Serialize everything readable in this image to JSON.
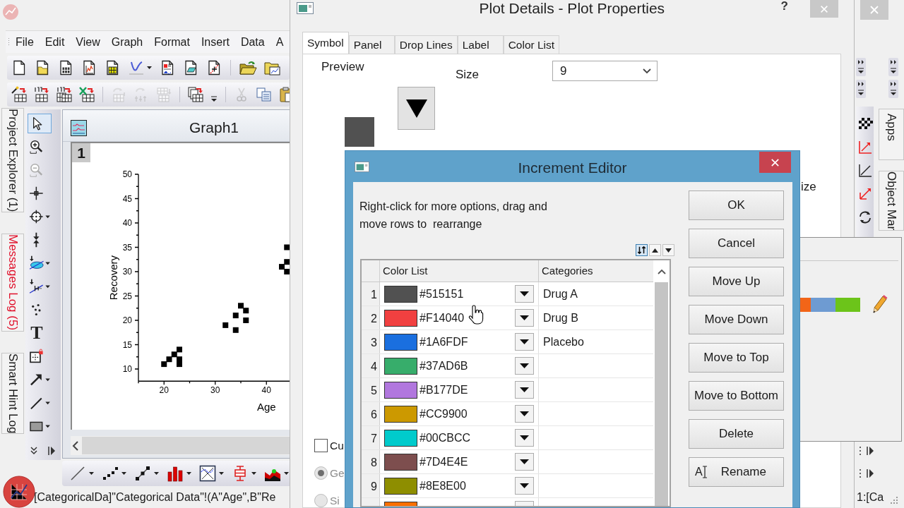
{
  "app": {
    "menu": [
      "File",
      "Edit",
      "View",
      "Graph",
      "Format",
      "Insert",
      "Data",
      "A"
    ],
    "toolbar_standard": [
      [
        {
          "kind": "new_project",
          "disabled": false
        },
        {
          "kind": "open",
          "disabled": false
        },
        {
          "kind": "new_workbook",
          "disabled": false
        },
        {
          "kind": "new_graph",
          "disabled": false
        },
        {
          "kind": "new_matrix",
          "disabled": false
        },
        {
          "kind": "new_function",
          "disabled": false
        },
        {
          "kind": "new_layout",
          "disabled": false
        },
        {
          "kind": "new_notes",
          "disabled": false
        },
        {
          "kind": "doc_marker",
          "disabled": false
        }
      ],
      [
        {
          "kind": "open_folder",
          "disabled": false
        },
        {
          "kind": "open_template",
          "disabled": false
        }
      ]
    ],
    "toolbar_import": [
      [
        {
          "kind": "import_wizard",
          "disabled": false
        },
        {
          "kind": "import_ascii",
          "disabled": false
        },
        {
          "kind": "import_multiple",
          "disabled": false
        },
        {
          "kind": "import_excel",
          "disabled": false
        }
      ],
      [
        {
          "kind": "reimport",
          "disabled": true
        },
        {
          "kind": "reimport_multi",
          "disabled": true
        },
        {
          "kind": "append_table",
          "disabled": true
        }
      ],
      [
        {
          "kind": "duplicate",
          "disabled": false
        },
        {
          "kind": "overflow",
          "disabled": false
        }
      ],
      [
        {
          "kind": "cut",
          "disabled": true
        },
        {
          "kind": "copy",
          "disabled": false
        },
        {
          "kind": "paste",
          "disabled": false
        }
      ]
    ],
    "side_tabs": [
      {
        "label": "Project Explorer (1)",
        "color": "#1a1a1a"
      },
      {
        "label": "Messages Log (5)",
        "color": "#e0102a"
      },
      {
        "label": "Smart Hint Log",
        "color": "#1a1a1a"
      }
    ],
    "tools": [
      {
        "kind": "pointer",
        "selected": true,
        "disabled": false
      },
      {
        "kind": "zoom_in",
        "selected": false,
        "disabled": false
      },
      {
        "kind": "zoom_out",
        "selected": false,
        "disabled": true
      },
      {
        "kind": "crosshair",
        "selected": false,
        "disabled": false
      },
      {
        "kind": "screen_reader",
        "selected": false,
        "disabled": false
      },
      {
        "kind": "data_selector",
        "selected": false,
        "disabled": false
      },
      {
        "kind": "roi",
        "selected": false,
        "disabled": false
      },
      {
        "kind": "mask",
        "selected": false,
        "disabled": false
      },
      {
        "kind": "draw_data",
        "selected": false,
        "disabled": false
      },
      {
        "kind": "text",
        "glyph": "T",
        "selected": false,
        "disabled": false
      },
      {
        "kind": "region",
        "selected": false,
        "disabled": false
      },
      {
        "kind": "arrow",
        "selected": false,
        "disabled": false
      },
      {
        "kind": "line",
        "selected": false,
        "disabled": false
      },
      {
        "kind": "rectangle",
        "selected": false,
        "disabled": false
      }
    ],
    "toolbar_graphs": [
      {
        "kind": "line"
      },
      {
        "kind": "scatter"
      },
      {
        "kind": "line_symbol"
      },
      {
        "kind": "column"
      },
      {
        "kind": "template"
      },
      {
        "kind": "box"
      },
      {
        "kind": "area"
      }
    ],
    "status_text": "[CategoricalDa]\"Categorical Data\"!(A\"Age\",B\"Re",
    "right_tabs": [
      "Apps",
      "Object Mar"
    ],
    "right_status": "1:[Ca"
  },
  "graph_window": {
    "title": "Graph1",
    "layer": "1",
    "chart_data": [
      {
        "type": "scatter",
        "xlabel": "Age",
        "ylabel": "Recovery",
        "x": [
          20,
          21,
          22,
          23,
          23,
          23,
          32,
          34,
          34,
          35,
          36,
          36,
          43,
          44,
          44,
          44
        ],
        "values": [
          11,
          12,
          13,
          14,
          12,
          11,
          19,
          21,
          18,
          23,
          22,
          20,
          31,
          35,
          32,
          30
        ],
        "color": "#000000",
        "marker": "square",
        "xticks": [
          20,
          30,
          40
        ],
        "yticks": [
          10,
          15,
          20,
          25,
          30,
          35,
          40,
          45,
          50
        ],
        "xlim": [
          15,
          65
        ],
        "ylim": [
          7.5,
          50
        ]
      }
    ]
  },
  "plot_details": {
    "title": "Plot Details - Plot Properties",
    "help": "?",
    "tabs": [
      {
        "label": "Symbol",
        "selected": true
      },
      {
        "label": "Panel",
        "selected": false
      },
      {
        "label": "Drop Lines",
        "selected": false
      },
      {
        "label": "Label",
        "selected": false
      },
      {
        "label": "Color List",
        "selected": false
      }
    ],
    "preview_label": "Preview",
    "size_label": "Size",
    "size_value": "9",
    "partial_label": "ize",
    "checkbox": {
      "label": "Cu",
      "checked": false
    },
    "radios": [
      {
        "label": "Ge",
        "selected": true,
        "disabled": true
      },
      {
        "label": "Si",
        "selected": false,
        "disabled": true
      }
    ]
  },
  "color_popup": {
    "swatches": [
      {
        "color": "#f26518"
      },
      {
        "color": "#6e9bd2"
      },
      {
        "color": "#6cc41a"
      }
    ]
  },
  "increment_editor": {
    "title": "Increment Editor",
    "instructions": "Right-click for more options, drag and move rows to  rearrange",
    "tool_buttons": [
      {
        "kind": "sort",
        "on": true
      },
      {
        "kind": "up",
        "on": false
      },
      {
        "kind": "down",
        "on": false
      }
    ],
    "columns": [
      "Color List",
      "Categories"
    ],
    "rows": [
      {
        "number": "1",
        "color": "#515151",
        "hex": "#515151",
        "category": "Drug A"
      },
      {
        "number": "2",
        "color": "#f14040",
        "hex": "#F14040",
        "category": "Drug B"
      },
      {
        "number": "3",
        "color": "#1a6fdf",
        "hex": "#1A6FDF",
        "category": "Placebo"
      },
      {
        "number": "4",
        "color": "#37ad6b",
        "hex": "#37AD6B"
      },
      {
        "number": "5",
        "color": "#b177de",
        "hex": "#B177DE"
      },
      {
        "number": "6",
        "color": "#cc9900",
        "hex": "#CC9900"
      },
      {
        "number": "7",
        "color": "#00cbcc",
        "hex": "#00CBCC"
      },
      {
        "number": "8",
        "color": "#7d4e4e",
        "hex": "#7D4E4E"
      },
      {
        "number": "9",
        "color": "#8e8e00",
        "hex": "#8E8E00"
      },
      {
        "color": "#fb6f01"
      }
    ],
    "buttons": [
      {
        "label": "OK"
      },
      {
        "label": "Cancel"
      },
      {
        "label": "Move Up"
      },
      {
        "label": "Move Down"
      },
      {
        "label": "Move to Top"
      },
      {
        "label": "Move to Bottom"
      },
      {
        "label": "Delete"
      },
      {
        "label": "Rename",
        "icon_glyph": "A"
      }
    ]
  }
}
